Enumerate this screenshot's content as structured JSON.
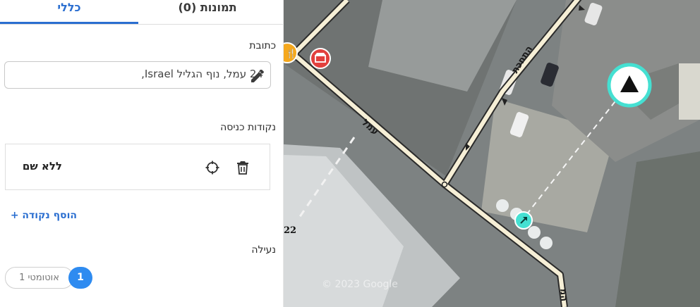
{
  "tabs": {
    "general": "כללי",
    "photos": "תמונות (0)"
  },
  "address": {
    "label": "כתובת",
    "value": "24 עמל, נוף הגליל Israel,"
  },
  "entry_points": {
    "label": "נקודות כניסה",
    "items": [
      {
        "name": "ללא שם"
      }
    ],
    "add_label": "הוסף נקודה +"
  },
  "lock": {
    "label": "נעילה",
    "auto_label": "אוטומטי 1",
    "level_label": "1"
  },
  "map": {
    "street_amal": "עמל",
    "street_other": "התחכת",
    "street_bottom": "המ",
    "credit": "© 2023 Google",
    "edge_number": "22",
    "colors": {
      "road_fill": "#f6efd6",
      "road_casing": "#2a2a2a",
      "entry_marker": "#45e0d2",
      "poi_red": "#e2403d",
      "poi_orange": "#f5a81d"
    }
  }
}
